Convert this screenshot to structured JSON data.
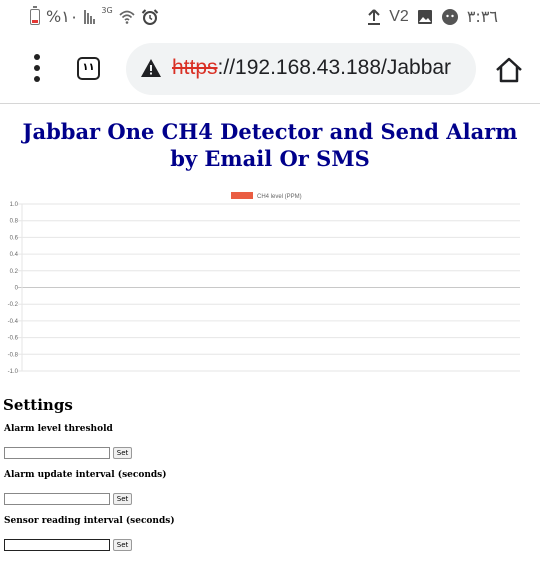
{
  "status_bar": {
    "battery_percent": "%١٠",
    "network_type": "3G",
    "volte_label": "V2",
    "time": "٣:٣٦",
    "left_icons": [
      "battery-icon",
      "signal-bars-icon",
      "wifi-icon",
      "alarm-clock-icon"
    ],
    "right_icons": [
      "upload-arrow-icon",
      "volte-icon",
      "image-icon",
      "face-icon"
    ]
  },
  "browser": {
    "tab_count": "١١",
    "url_scheme": "https",
    "url_rest": "://192.168.43.188/Jabbar",
    "security": "not-secure"
  },
  "page": {
    "title": "Jabbar One CH4 Detector and Send Alarm by Email Or SMS"
  },
  "chart_data": {
    "type": "line",
    "series": [
      {
        "name": "CH4 level (PPM)",
        "color": "#ea5d42",
        "values": []
      }
    ],
    "yticks": [
      "1.0",
      "0.8",
      "0.6",
      "0.4",
      "0.2",
      "0",
      "-0.2",
      "-0.4",
      "-0.6",
      "-0.8",
      "-1.0"
    ],
    "ylim": [
      -1.0,
      1.0
    ],
    "legend": "top-center",
    "grid": true
  },
  "settings": {
    "title": "Settings",
    "fields": [
      {
        "label": "Alarm level threshold",
        "value": "",
        "button": "Set"
      },
      {
        "label": "Alarm update interval (seconds)",
        "value": "",
        "button": "Set"
      },
      {
        "label": "Sensor reading interval (seconds)",
        "value": "",
        "button": "Set"
      }
    ]
  }
}
